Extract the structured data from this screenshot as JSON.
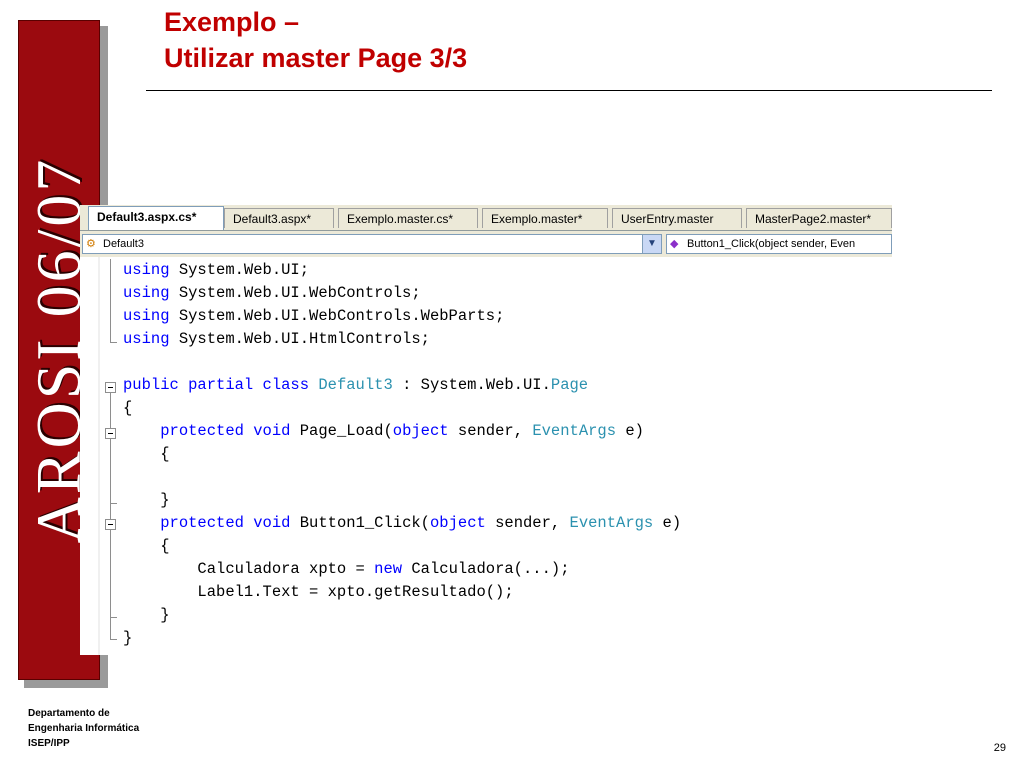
{
  "slide": {
    "title_line1": "Exemplo –",
    "title_line2": "Utilizar master Page 3/3",
    "banner": "AROSI 06/07",
    "footer": [
      "Departamento de",
      "Engenharia Informática",
      "ISEP/IPP"
    ],
    "page_number": "29"
  },
  "ide": {
    "tabs": [
      {
        "label": "Default3.aspx.cs*",
        "active": true
      },
      {
        "label": "Default3.aspx*",
        "active": false
      },
      {
        "label": "Exemplo.master.cs*",
        "active": false
      },
      {
        "label": "Exemplo.master*",
        "active": false
      },
      {
        "label": "UserEntry.master",
        "active": false
      },
      {
        "label": "MasterPage2.master*",
        "active": false
      }
    ],
    "class_dropdown": {
      "value": "Default3",
      "icon": "class-icon"
    },
    "member_dropdown": {
      "value": "Button1_Click(object sender, Even",
      "icon": "method-icon"
    },
    "code": {
      "l1_kw": "using",
      "l1_rest": " System.Web.UI;",
      "l2_kw": "using",
      "l2_rest": " System.Web.UI.WebControls;",
      "l3_kw": "using",
      "l3_rest": " System.Web.UI.WebControls.WebParts;",
      "l4_kw": "using",
      "l4_rest": " System.Web.UI.HtmlControls;",
      "l6_kw": "public partial class",
      "l6_type": "Default3",
      "l6_mid": " : System.Web.UI.",
      "l6_base": "Page",
      "l7": "{",
      "l8_indent": "    ",
      "l8_kw": "protected void",
      "l8_mid": " Page_Load(",
      "l8_kw2": "object",
      "l8_mid2": " sender, ",
      "l8_type": "EventArgs",
      "l8_end": " e)",
      "l9": "    {",
      "l11": "    }",
      "l12_indent": "    ",
      "l12_kw": "protected void",
      "l12_mid": " Button1_Click(",
      "l12_kw2": "object",
      "l12_mid2": " sender, ",
      "l12_type": "EventArgs",
      "l12_end": " e)",
      "l13": "    {",
      "l14_start": "        Calculadora xpto = ",
      "l14_kw": "new",
      "l14_end": " Calculadora(...);",
      "l15": "        Label1.Text = xpto.getResultado();",
      "l16": "    }",
      "l17": "}"
    },
    "colors": {
      "keyword": "#0000ff",
      "type": "#2b91af",
      "banner": "#9b0a0f",
      "title": "#c00000"
    }
  }
}
